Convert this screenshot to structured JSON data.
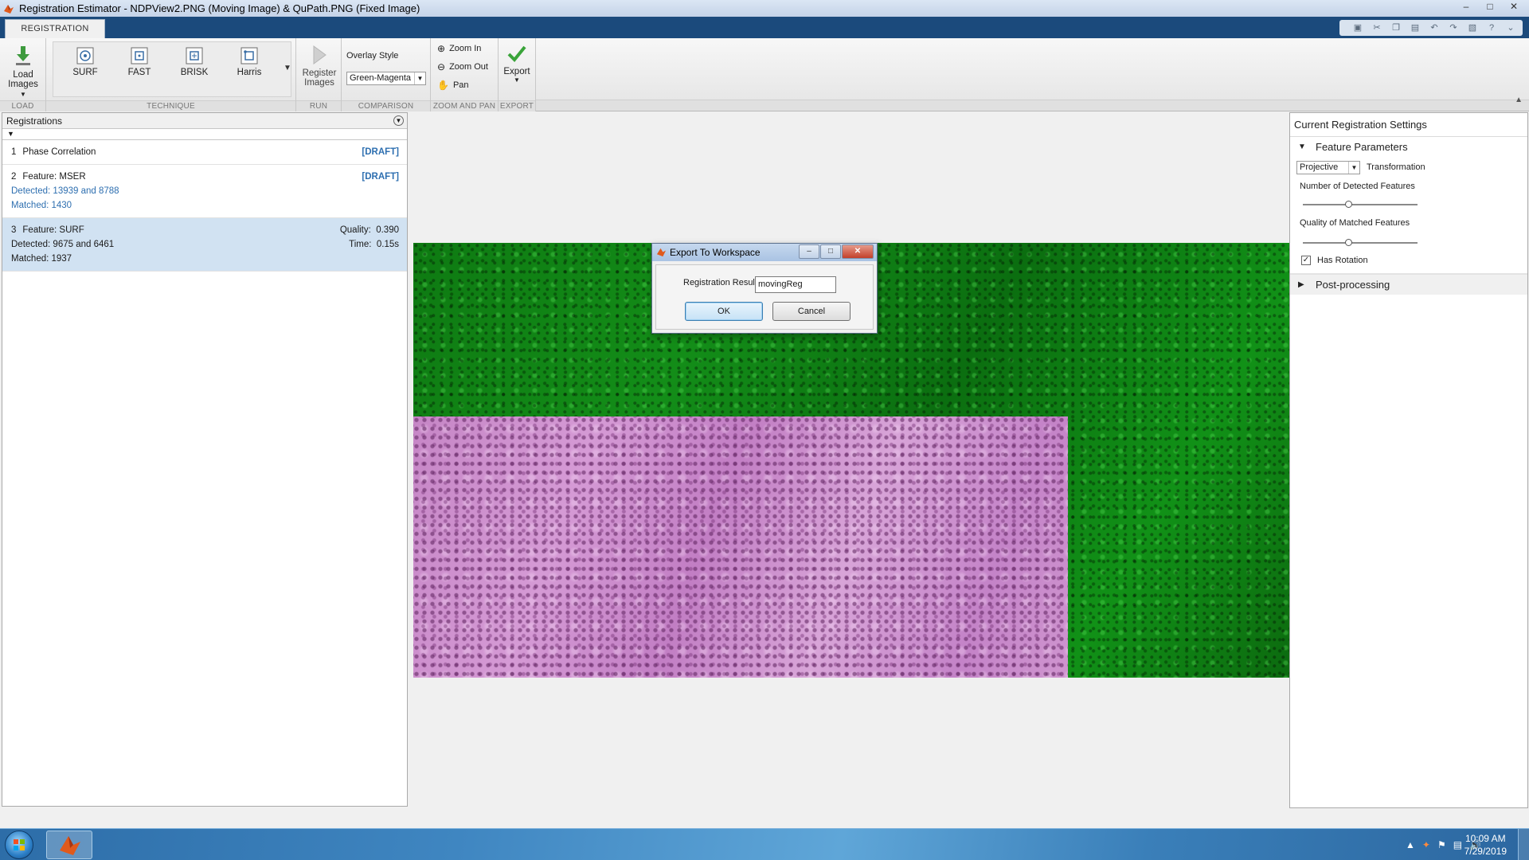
{
  "window": {
    "title": "Registration Estimator - NDPView2.PNG (Moving Image) & QuPath.PNG (Fixed Image)"
  },
  "tabs": [
    {
      "label": "REGISTRATION"
    }
  ],
  "toolstrip": {
    "load": {
      "button_label_1": "Load",
      "button_label_2": "Images",
      "section": "LOAD"
    },
    "technique": {
      "section": "TECHNIQUE",
      "buttons": [
        {
          "label": "SURF"
        },
        {
          "label": "FAST"
        },
        {
          "label": "BRISK"
        },
        {
          "label": "Harris"
        }
      ]
    },
    "run": {
      "button_label_1": "Register",
      "button_label_2": "Images",
      "section": "RUN"
    },
    "comparison": {
      "section": "COMPARISON",
      "overlay_label": "Overlay Style",
      "overlay_value": "Green-Magenta"
    },
    "zoom": {
      "section": "ZOOM AND PAN",
      "zoom_in": "Zoom In",
      "zoom_out": "Zoom Out",
      "pan": "Pan"
    },
    "export": {
      "section": "EXPORT",
      "button_label": "Export"
    }
  },
  "left_panel": {
    "title": "Registrations",
    "items": [
      {
        "number": "1",
        "name": "Phase Correlation",
        "badge": "[DRAFT]"
      },
      {
        "number": "2",
        "name": "Feature: MSER",
        "badge": "[DRAFT]",
        "detected": "Detected: 13939 and 8788",
        "matched": "Matched: 1430"
      },
      {
        "number": "3",
        "name": "Feature: SURF",
        "detected": "Detected: 9675 and 6461",
        "matched": "Matched: 1937",
        "quality_label": "Quality:",
        "quality_value": "0.390",
        "time_label": "Time:",
        "time_value": "0.15s"
      }
    ]
  },
  "right_panel": {
    "title": "Current Registration Settings",
    "feature_group": "Feature Parameters",
    "transformation_value": "Projective",
    "transformation_label": "Transformation",
    "detected_label": "Number of Detected Features",
    "detected_level": 0.4,
    "matched_label": "Quality of Matched Features",
    "matched_level": 0.4,
    "rotation_label": "Has Rotation",
    "rotation_checked": true,
    "postprocessing_group": "Post-processing"
  },
  "dialog": {
    "title": "Export To Workspace",
    "field_label": "Registration Results",
    "field_value": "movingReg",
    "ok": "OK",
    "cancel": "Cancel"
  },
  "taskbar": {
    "time": "10:09 AM",
    "date": "7/29/2019"
  },
  "colors": {
    "tab_strip": "#1b4a7c",
    "accent_blue": "#2e6fb0",
    "selection": "#d1e2f2",
    "overlay_fixed": "#0e7a12",
    "overlay_moving": "#c686c6"
  }
}
